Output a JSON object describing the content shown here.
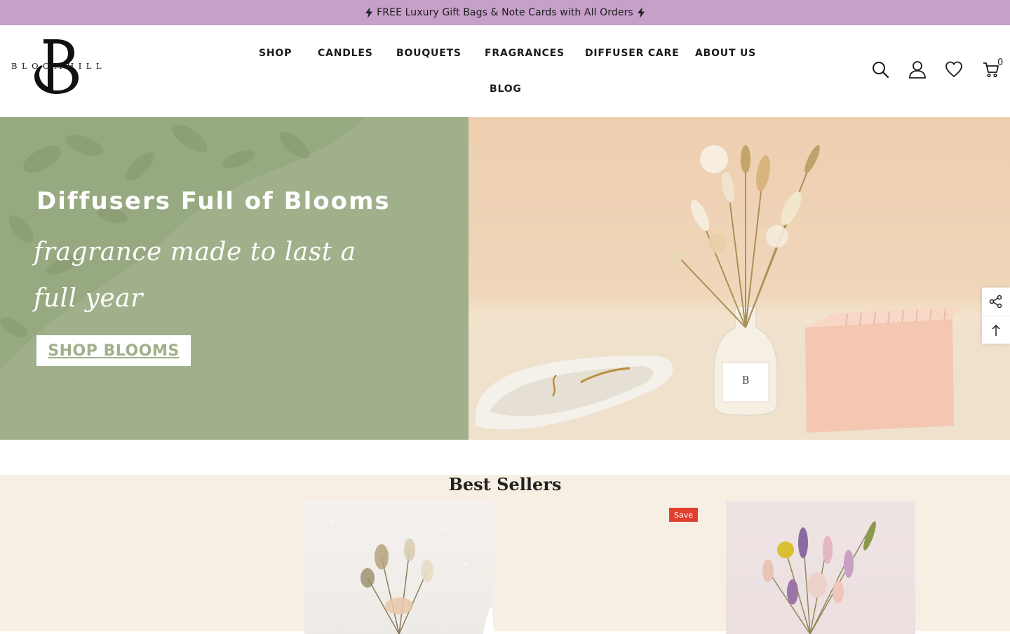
{
  "announcement": {
    "text": "FREE Luxury Gift Bags & Note Cards with All Orders"
  },
  "brand": {
    "logo_text": "BLOOMHILL",
    "monogram": "B"
  },
  "nav": {
    "items": [
      {
        "label": "SHOP"
      },
      {
        "label": "CANDLES"
      },
      {
        "label": "BOUQUETS"
      },
      {
        "label": "FRAGRANCES"
      },
      {
        "label": "DIFFUSER CARE"
      },
      {
        "label": "ABOUT US"
      },
      {
        "label": "BLOG"
      }
    ]
  },
  "header_icons": {
    "search": "search-icon",
    "account": "user-icon",
    "wishlist": "heart-icon",
    "cart": "cart-icon",
    "cart_count": "0"
  },
  "hero": {
    "title": "Diffusers Full of Blooms",
    "subtitle": "fragrance made to last a full year",
    "button_label": "SHOP BLOOMS",
    "bg_left": "#9fb08a"
  },
  "side_tools": {
    "share": "share-icon",
    "top": "arrow-up-icon"
  },
  "best_sellers": {
    "title": "Best Sellers",
    "badge": "Save"
  },
  "colors": {
    "announcement_bg": "#c6a0c9",
    "accent_green": "#9fb08a",
    "section_bg": "#f8efe4",
    "save_badge": "#e0402e"
  }
}
